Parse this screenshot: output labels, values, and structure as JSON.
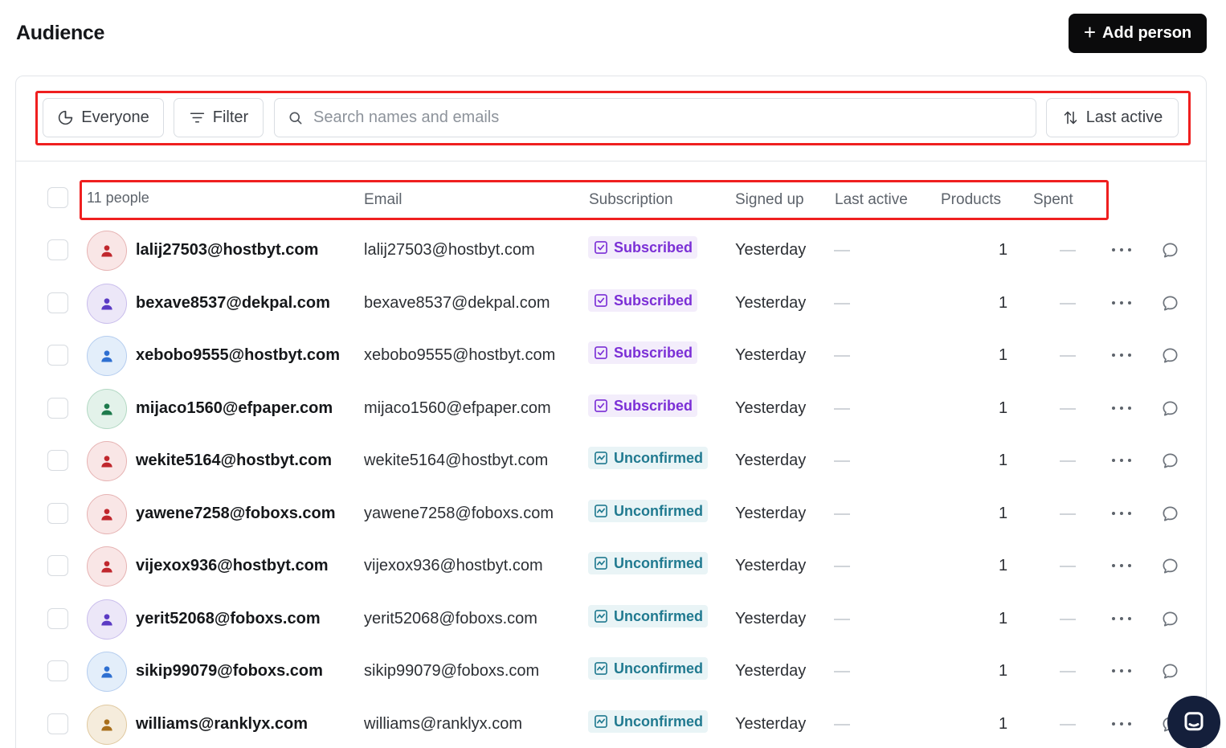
{
  "header": {
    "title": "Audience",
    "add_button_label": "Add person"
  },
  "toolbar": {
    "segment_label": "Everyone",
    "filter_label": "Filter",
    "search_placeholder": "Search names and emails",
    "search_value": "",
    "sort_label": "Last active"
  },
  "table": {
    "count_label": "11 people",
    "columns": {
      "email": "Email",
      "subscription": "Subscription",
      "signed_up": "Signed up",
      "last_active": "Last active",
      "products": "Products",
      "spent": "Spent"
    },
    "rows": [
      {
        "name": "lalij27503@hostbyt.com",
        "email": "lalij27503@hostbyt.com",
        "status": "Subscribed",
        "status_type": "subscribed",
        "signed_up": "Yesterday",
        "products": "1",
        "avatar_color": "red"
      },
      {
        "name": "bexave8537@dekpal.com",
        "email": "bexave8537@dekpal.com",
        "status": "Subscribed",
        "status_type": "subscribed",
        "signed_up": "Yesterday",
        "products": "1",
        "avatar_color": "purple"
      },
      {
        "name": "xebobo9555@hostbyt.com",
        "email": "xebobo9555@hostbyt.com",
        "status": "Subscribed",
        "status_type": "subscribed",
        "signed_up": "Yesterday",
        "products": "1",
        "avatar_color": "blue"
      },
      {
        "name": "mijaco1560@efpaper.com",
        "email": "mijaco1560@efpaper.com",
        "status": "Subscribed",
        "status_type": "subscribed",
        "signed_up": "Yesterday",
        "products": "1",
        "avatar_color": "green"
      },
      {
        "name": "wekite5164@hostbyt.com",
        "email": "wekite5164@hostbyt.com",
        "status": "Unconfirmed",
        "status_type": "unconfirmed",
        "signed_up": "Yesterday",
        "products": "1",
        "avatar_color": "red"
      },
      {
        "name": "yawene7258@foboxs.com",
        "email": "yawene7258@foboxs.com",
        "status": "Unconfirmed",
        "status_type": "unconfirmed",
        "signed_up": "Yesterday",
        "products": "1",
        "avatar_color": "red"
      },
      {
        "name": "vijexox936@hostbyt.com",
        "email": "vijexox936@hostbyt.com",
        "status": "Unconfirmed",
        "status_type": "unconfirmed",
        "signed_up": "Yesterday",
        "products": "1",
        "avatar_color": "red"
      },
      {
        "name": "yerit52068@foboxs.com",
        "email": "yerit52068@foboxs.com",
        "status": "Unconfirmed",
        "status_type": "unconfirmed",
        "signed_up": "Yesterday",
        "products": "1",
        "avatar_color": "purple"
      },
      {
        "name": "sikip99079@foboxs.com",
        "email": "sikip99079@foboxs.com",
        "status": "Unconfirmed",
        "status_type": "unconfirmed",
        "signed_up": "Yesterday",
        "products": "1",
        "avatar_color": "blue"
      },
      {
        "name": "williams@ranklyx.com",
        "email": "williams@ranklyx.com",
        "status": "Unconfirmed",
        "status_type": "unconfirmed",
        "signed_up": "Yesterday",
        "products": "1",
        "avatar_color": "gold"
      }
    ]
  },
  "colors": {
    "primary_button": "#0b0b0c",
    "highlight_box": "#ef1f1f",
    "subscribed_text": "#7b2fd6",
    "subscribed_bg": "#f3edfb",
    "unconfirmed_text": "#217a90",
    "unconfirmed_bg": "#e9f4f6",
    "chat_widget": "#141f3b",
    "avatar_palette": {
      "red": {
        "bg": "#f9e6e6",
        "border": "#e6b3b3",
        "icon": "#c0272d"
      },
      "purple": {
        "bg": "#ece7f8",
        "border": "#c9bdec",
        "icon": "#5b3bc4"
      },
      "blue": {
        "bg": "#e3eefa",
        "border": "#b5cdef",
        "icon": "#2e6fd1"
      },
      "green": {
        "bg": "#e3f2ea",
        "border": "#b2d8c3",
        "icon": "#1d7a4c"
      },
      "gold": {
        "bg": "#f5ecdc",
        "border": "#e0c9a0",
        "icon": "#a86f1c"
      }
    }
  },
  "icons": {
    "segment": "pie-chart-icon",
    "filter": "filter-lines-icon",
    "search": "search-icon",
    "sort": "sort-arrows-icon",
    "add": "plus-icon",
    "row_more": "more-horizontal-icon",
    "row_comment": "comment-icon",
    "avatar": "person-icon",
    "subscribed": "checkbox-checked-icon",
    "unconfirmed": "activity-icon",
    "chat": "chat-icon"
  }
}
